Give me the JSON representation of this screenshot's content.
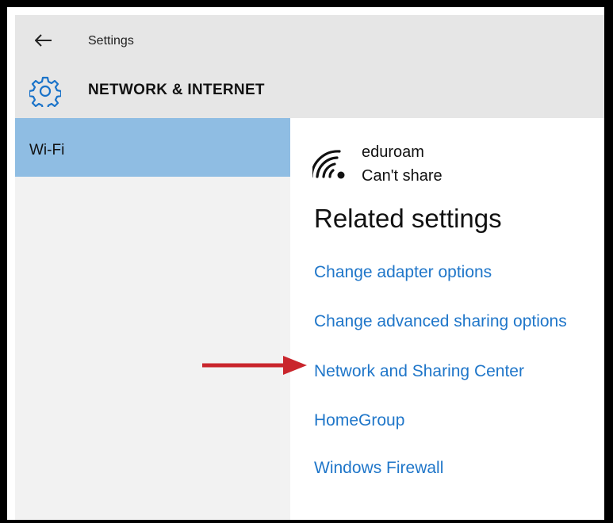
{
  "header": {
    "app_title": "Settings",
    "section_title": "NETWORK & INTERNET",
    "back_icon": "arrow-left-icon",
    "section_icon": "gear-icon",
    "background_color": "#e6e6e6"
  },
  "sidebar": {
    "items": [
      {
        "label": "Wi-Fi",
        "selected": true
      }
    ],
    "selected_color": "#8fbde3"
  },
  "main": {
    "network": {
      "icon": "wifi-signal-icon",
      "name": "eduroam",
      "status": "Can't share"
    },
    "related_settings": {
      "title": "Related settings",
      "links": [
        "Change adapter options",
        "Change advanced sharing options",
        "Network and Sharing Center",
        "HomeGroup",
        "Windows Firewall"
      ],
      "link_color": "#1f76c9"
    }
  },
  "annotation": {
    "type": "arrow",
    "color": "#c9252c",
    "points_to": "Network and Sharing Center"
  }
}
